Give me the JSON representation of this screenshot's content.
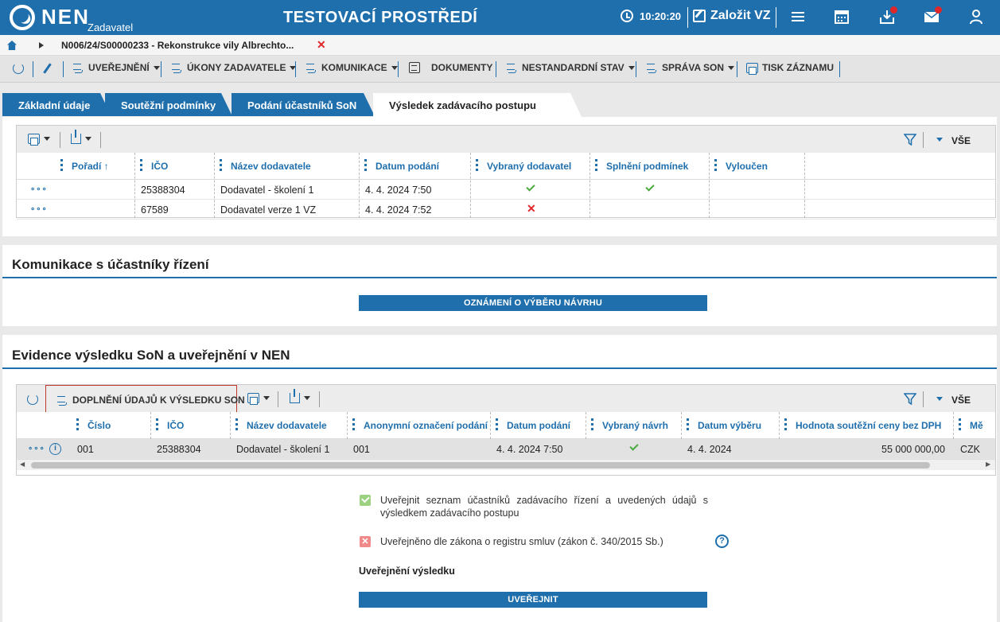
{
  "header": {
    "logo_text": "NEN",
    "logo_sub": "Zadavatel",
    "env_title": "TESTOVACÍ PROSTŘEDÍ",
    "clock": "10:20:20",
    "create_label": "Založit VZ",
    "icons": [
      "menu-icon",
      "calendar-icon",
      "inbox-icon",
      "mail-icon",
      "user-icon"
    ]
  },
  "breadcrumb": {
    "text": "N006/24/S00000233 - Rekonstrukce vily Albrechto...",
    "close": "✕"
  },
  "toolbar": {
    "items": [
      "UVEŘEJNĚNÍ",
      "ÚKONY ZADAVATELE",
      "KOMUNIKACE",
      "DOKUMENTY",
      "NESTANDARDNÍ STAV",
      "SPRÁVA SON",
      "TISK ZÁZNAMU"
    ]
  },
  "tabs": [
    "Základní údaje",
    "Soutěžní podmínky",
    "Podání účastníků SoN",
    "Výsledek zadávacího postupu"
  ],
  "grid1": {
    "filter_all": "VŠE",
    "headers": [
      "Pořadí ↑",
      "IČO",
      "Název dodavatele",
      "Datum podání",
      "Vybraný dodavatel",
      "Splnění podmínek",
      "Vyloučen"
    ],
    "rows": [
      {
        "more": "∘∘∘",
        "ico": "25388304",
        "name": "Dodavatel - školení 1",
        "date": "4. 4. 2024 7:50",
        "selected": "check",
        "conditions": "check"
      },
      {
        "more": "∘∘∘",
        "ico": "67589",
        "name": "Dodavatel verze 1 VZ",
        "date": "4. 4. 2024 7:52",
        "selected": "cross",
        "conditions": ""
      }
    ]
  },
  "section_comm": {
    "title": "Komunikace s účastníky řízení",
    "button": "OZNÁMENÍ O VÝBĚRU NÁVRHU"
  },
  "section_evid": {
    "title": "Evidence výsledku SoN a uveřejnění v NEN",
    "action_button": "DOPLNĚNÍ ÚDAJŮ K VÝSLEDKU SON",
    "filter_all": "VŠE",
    "headers": [
      "Číslo",
      "IČO",
      "Název dodavatele",
      "Anonymní označení podání",
      "Datum podání",
      "Vybraný návrh",
      "Datum výběru",
      "Hodnota soutěžní ceny bez DPH",
      "Mě"
    ],
    "rows": [
      {
        "more": "∘∘∘",
        "number": "001",
        "ico": "25388304",
        "name": "Dodavatel - školení 1",
        "anon": "001",
        "date": "4. 4. 2024 7:50",
        "selected": "check",
        "sel_date": "4. 4. 2024",
        "value": "55 000 000,00",
        "currency": "CZK"
      }
    ],
    "checkbox1_text": "Uveřejnit seznam účastníků zadávacího řízení a uvedených údajů s výsledkem zadávacího postupu",
    "checkbox2_text": "Uveřejněno dle zákona o registru smluv (zákon č. 340/2015 Sb.)",
    "help": "?",
    "publish_label": "Uveřejnění výsledku",
    "publish_button": "UVEŘEJNIT"
  },
  "colors": {
    "primary": "#1f6fad",
    "check": "#4aaa3c",
    "cross": "#e0262a"
  }
}
